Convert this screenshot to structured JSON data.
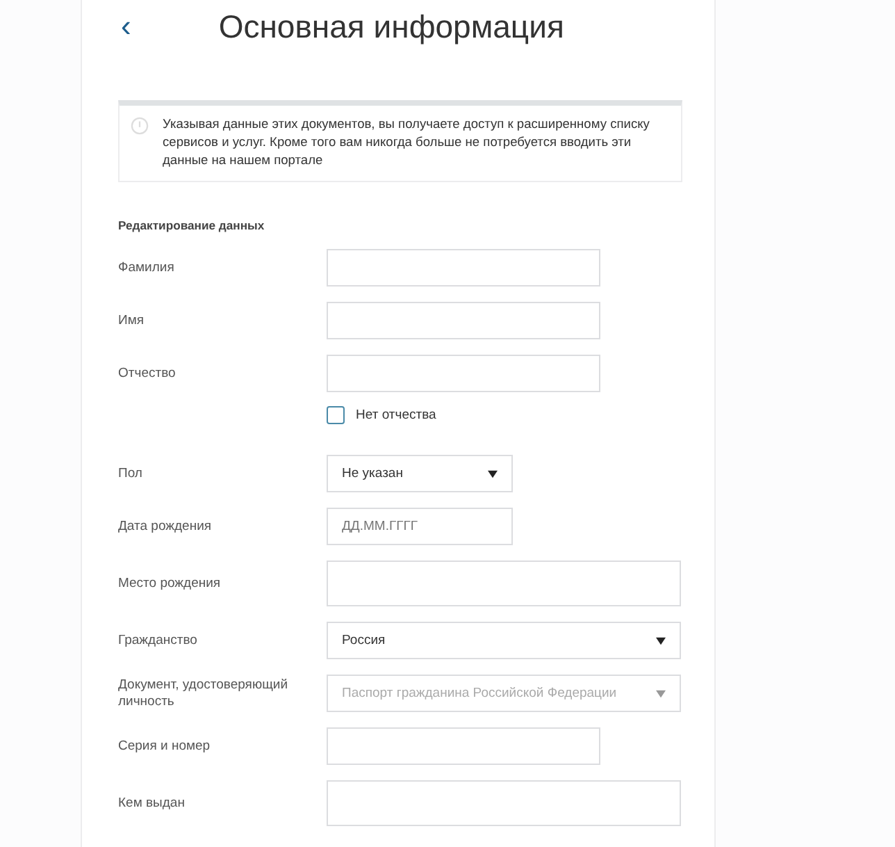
{
  "header": {
    "back": "‹",
    "title": "Основная информация"
  },
  "notice": {
    "text": "Указывая данные этих документов, вы получаете доступ к расширенному списку сервисов и услуг. Кроме того вам никогда больше не потребуется вводить эти данные на нашем портале"
  },
  "section": {
    "title": "Редактирование данных"
  },
  "rows": [
    {
      "kind": "text",
      "label": "Фамилия",
      "value": ""
    },
    {
      "kind": "text",
      "label": "Имя",
      "value": ""
    },
    {
      "kind": "text",
      "label": "Отчество",
      "value": ""
    },
    {
      "kind": "checkbox",
      "label": "Нет отчества",
      "checked": false
    },
    {
      "kind": "select",
      "label": "Пол",
      "value": "Не указан",
      "disabled": false
    },
    {
      "kind": "date",
      "label": "Дата рождения",
      "placeholder": "ДД.ММ.ГГГГ"
    },
    {
      "kind": "text-wide",
      "label": "Место рождения",
      "value": ""
    },
    {
      "kind": "select-wide",
      "label": "Гражданство",
      "value": "Россия",
      "disabled": false
    },
    {
      "kind": "select-wide",
      "label": "Документ, удостоверяющий личность",
      "value": "Паспорт гражданина Российской Федерации",
      "disabled": true
    },
    {
      "kind": "text",
      "label": "Серия и номер",
      "value": ""
    },
    {
      "kind": "text-wide",
      "label": "Кем выдан",
      "value": ""
    }
  ]
}
